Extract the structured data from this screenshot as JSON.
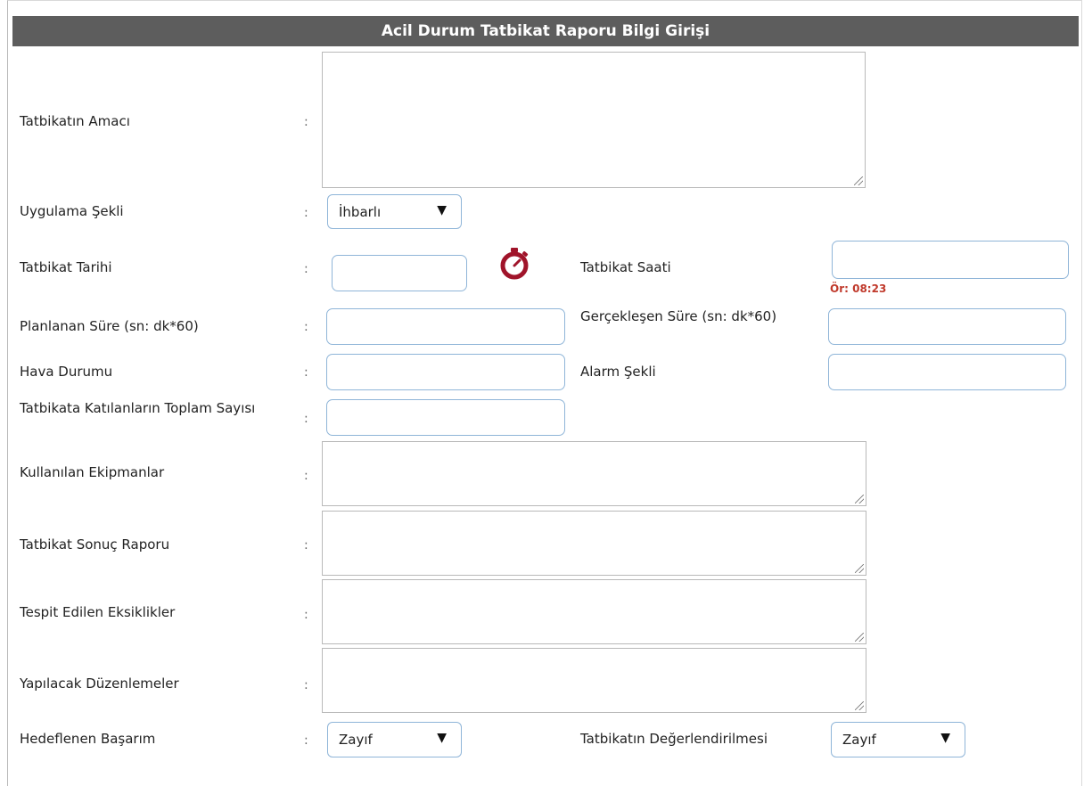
{
  "form": {
    "title": "Acil Durum Tatbikat Raporu Bilgi Girişi",
    "colon": ":",
    "fields": {
      "amac": {
        "label": "Tatbikatın Amacı",
        "value": ""
      },
      "uygulama": {
        "label": "Uygulama Şekli",
        "selected": "İhbarlı"
      },
      "tarih": {
        "label": "Tatbikat Tarihi",
        "value": ""
      },
      "saat": {
        "label": "Tatbikat Saati",
        "value": "",
        "hint": "Ör: 08:23"
      },
      "planlanan": {
        "label": "Planlanan Süre (sn: dk*60)",
        "value": ""
      },
      "gerceklesen": {
        "label": "Gerçekleşen Süre (sn: dk*60)",
        "value": ""
      },
      "hava": {
        "label": "Hava Durumu",
        "value": ""
      },
      "alarm": {
        "label": "Alarm Şekli",
        "value": ""
      },
      "katilanlar": {
        "label": "Tatbikata Katılanların Toplam Sayısı",
        "value": ""
      },
      "ekipman": {
        "label": "Kullanılan Ekipmanlar",
        "value": ""
      },
      "sonuc": {
        "label": "Tatbikat Sonuç Raporu",
        "value": ""
      },
      "eksiklik": {
        "label": "Tespit Edilen Eksiklikler",
        "value": ""
      },
      "duzenleme": {
        "label": "Yapılacak Düzenlemeler",
        "value": ""
      },
      "hedef": {
        "label": "Hedeflenen Başarım",
        "selected": "Zayıf"
      },
      "degerlendirme": {
        "label": "Tatbikatın Değerlendirilmesi",
        "selected": "Zayıf"
      }
    }
  },
  "icons": {
    "timer": "stopwatch-icon",
    "timer_color": "#a0142a"
  },
  "colors": {
    "header_bg": "#5d5d5d",
    "input_border": "#8fb5d8",
    "hint": "#c0392b"
  }
}
